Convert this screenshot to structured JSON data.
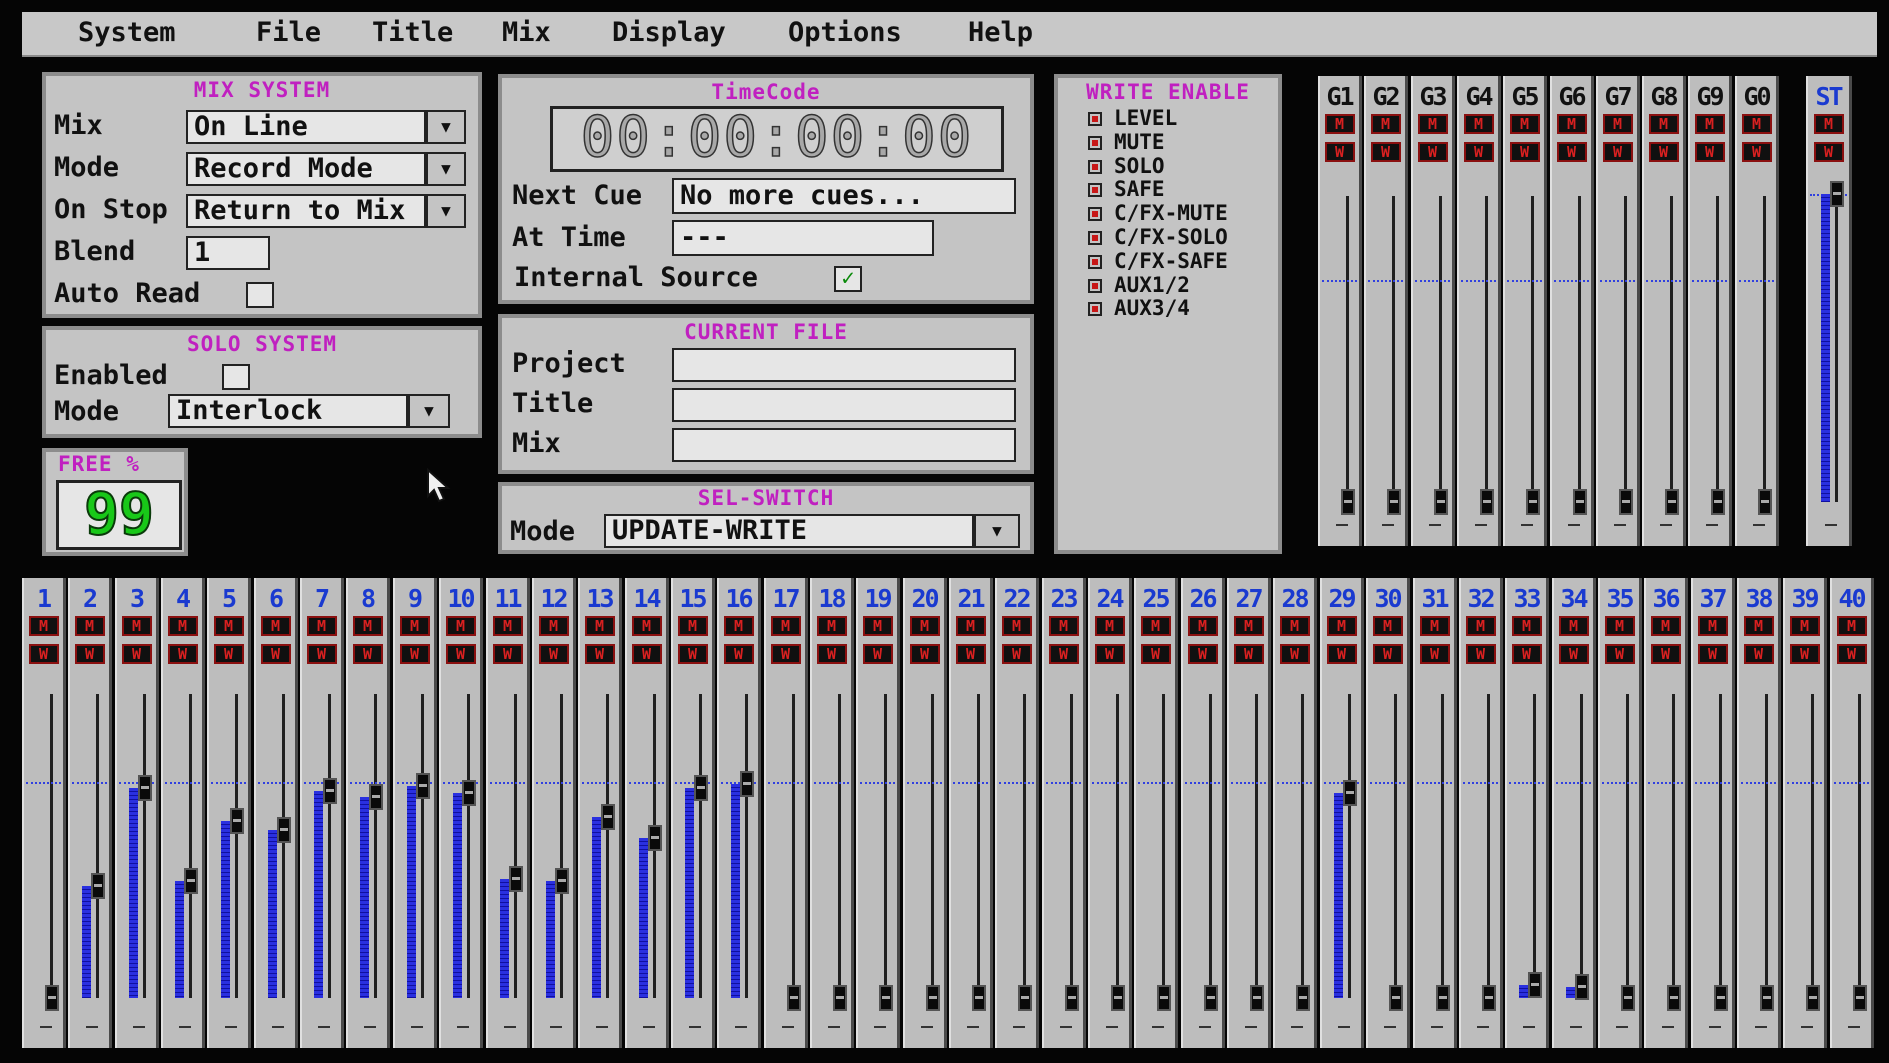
{
  "menu": [
    "System",
    "File",
    "Title",
    "Mix",
    "Display",
    "Options",
    "Help"
  ],
  "mix_system": {
    "title": "MIX  SYSTEM",
    "mix_label": "Mix",
    "mix_value": "On Line",
    "mode_label": "Mode",
    "mode_value": "Record Mode",
    "onstop_label": "On Stop",
    "onstop_value": "Return to Mix",
    "blend_label": "Blend",
    "blend_value": "1",
    "autoread_label": "Auto Read"
  },
  "solo_system": {
    "title": "SOLO  SYSTEM",
    "enabled_label": "Enabled",
    "mode_label": "Mode",
    "mode_value": "Interlock"
  },
  "free": {
    "label": "FREE  %",
    "value": "99"
  },
  "timecode": {
    "title": "TimeCode",
    "value": "00:00:00:00",
    "next_cue_label": "Next Cue",
    "next_cue_value": "No more cues...",
    "at_time_label": "At Time",
    "at_time_value": "---",
    "internal_source_label": "Internal Source",
    "internal_source_checked": true,
    "check_glyph": "✓"
  },
  "current_file": {
    "title": "CURRENT  FILE",
    "project_label": "Project",
    "project_value": "",
    "title_label": "Title",
    "title_value": "",
    "mix_label": "Mix",
    "mix_value": ""
  },
  "sel_switch": {
    "title": "SEL-SWITCH",
    "mode_label": "Mode",
    "mode_value": "UPDATE-WRITE"
  },
  "write_enable": {
    "title": "WRITE  ENABLE",
    "items": [
      "LEVEL",
      "MUTE",
      "SOLO",
      "SAFE",
      "C/FX-MUTE",
      "C/FX-SOLO",
      "C/FX-SAFE",
      "AUX1/2",
      "AUX3/4"
    ]
  },
  "buttons": {
    "mute": "M",
    "write": "W",
    "dropdown": "▼"
  },
  "groups": {
    "labels": [
      "G1",
      "G2",
      "G3",
      "G4",
      "G5",
      "G6",
      "G7",
      "G8",
      "G9",
      "G0"
    ],
    "levels": [
      0,
      0,
      0,
      0,
      0,
      0,
      0,
      0,
      0,
      0
    ]
  },
  "stereo": {
    "label": "ST",
    "level": 1.0
  },
  "channels": {
    "labels": [
      "1",
      "2",
      "3",
      "4",
      "5",
      "6",
      "7",
      "8",
      "9",
      "10",
      "11",
      "12",
      "13",
      "14",
      "15",
      "16",
      "17",
      "18",
      "19",
      "20",
      "21",
      "22",
      "23",
      "24",
      "25",
      "26",
      "27",
      "28",
      "29",
      "30",
      "31",
      "32",
      "33",
      "34",
      "35",
      "36",
      "37",
      "38",
      "39",
      "40"
    ],
    "levels": [
      0.0,
      0.52,
      0.97,
      0.54,
      0.82,
      0.78,
      0.96,
      0.93,
      0.98,
      0.95,
      0.55,
      0.54,
      0.84,
      0.74,
      0.97,
      0.99,
      0,
      0,
      0,
      0,
      0,
      0,
      0,
      0,
      0,
      0,
      0,
      0,
      0.95,
      0,
      0,
      0,
      0.06,
      0.05,
      0,
      0,
      0,
      0,
      0,
      0
    ]
  },
  "colors": {
    "panel": "#c4c4c4",
    "title": "#c020c0",
    "meter": "#2a30e0",
    "timecode_text": "#a8a8a8",
    "free_text": "#18c818",
    "mute_red": "#d82020"
  }
}
